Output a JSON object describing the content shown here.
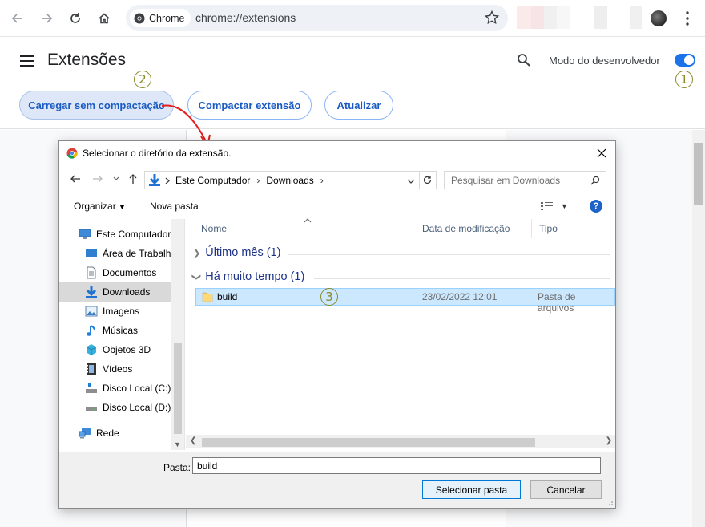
{
  "browser": {
    "chip_label": "Chrome",
    "url": "chrome://extensions"
  },
  "extensions_page": {
    "title": "Extensões",
    "dev_mode_label": "Modo do desenvolvedor",
    "dev_mode_on": true,
    "buttons": {
      "load_unpacked": "Carregar sem compactação",
      "pack": "Compactar extensão",
      "update": "Atualizar"
    },
    "markers": {
      "m1": "1",
      "m2": "2",
      "m3": "3"
    }
  },
  "dialog": {
    "title": "Selecionar o diretório da extensão.",
    "breadcrumbs": [
      "Este Computador",
      "Downloads"
    ],
    "search_placeholder": "Pesquisar em Downloads",
    "organize": "Organizar",
    "new_folder": "Nova pasta",
    "help": "?",
    "nav_items": [
      {
        "label": "Este Computador",
        "icon": "computer-icon"
      },
      {
        "label": "Área de Trabalho",
        "icon": "desktop-icon"
      },
      {
        "label": "Documentos",
        "icon": "documents-icon"
      },
      {
        "label": "Downloads",
        "icon": "downloads-icon"
      },
      {
        "label": "Imagens",
        "icon": "images-icon"
      },
      {
        "label": "Músicas",
        "icon": "music-icon"
      },
      {
        "label": "Objetos 3D",
        "icon": "objects-3d-icon"
      },
      {
        "label": "Vídeos",
        "icon": "videos-icon"
      },
      {
        "label": "Disco Local (C:)",
        "icon": "drive-icon"
      },
      {
        "label": "Disco Local (D:)",
        "icon": "drive-icon"
      },
      {
        "label": "Rede",
        "icon": "network-icon"
      }
    ],
    "columns": {
      "name": "Nome",
      "date": "Data de modificação",
      "type": "Tipo"
    },
    "groups": {
      "last_month": "Último mês (1)",
      "long_ago": "Há muito tempo (1)"
    },
    "selected_file": {
      "name": "build",
      "date": "23/02/2022 12:01",
      "type": "Pasta de arquivos"
    },
    "folder_label": "Pasta:",
    "folder_value": "build",
    "select_button": "Selecionar pasta",
    "cancel_button": "Cancelar"
  }
}
